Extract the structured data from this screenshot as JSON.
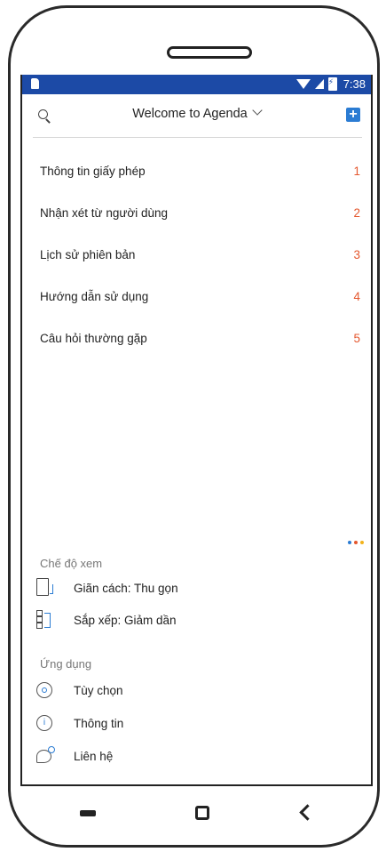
{
  "status_bar": {
    "time": "7:38"
  },
  "header": {
    "title": "Welcome to Agenda"
  },
  "list": [
    {
      "label": "Thông tin giấy phép",
      "number": "1"
    },
    {
      "label": "Nhận xét từ người dùng",
      "number": "2"
    },
    {
      "label": "Lịch sử phiên bản",
      "number": "3"
    },
    {
      "label": "Hướng dẫn sử dụng",
      "number": "4"
    },
    {
      "label": "Câu hỏi thường gặp",
      "number": "5"
    }
  ],
  "view_section": {
    "label": "Chế độ xem",
    "spacing": "Giãn cách: Thu gọn",
    "sort": "Sắp xếp: Giảm dần"
  },
  "app_section": {
    "label": "Ứng dụng",
    "options": "Tùy chọn",
    "info": "Thông tin",
    "contact": "Liên hệ"
  },
  "colors": {
    "status_bar": "#1c4aa6",
    "accent": "#2b7cd3",
    "number": "#e4572e",
    "dots": [
      "#2b7cd3",
      "#e4572e",
      "#f2b31b"
    ]
  }
}
